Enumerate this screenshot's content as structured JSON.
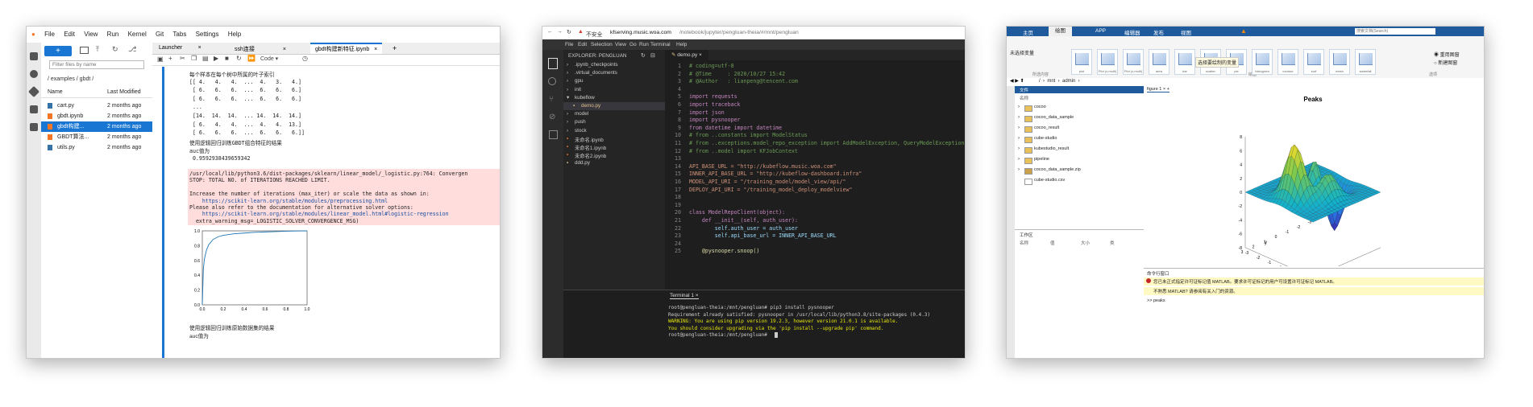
{
  "jupyter": {
    "menu": [
      "File",
      "Edit",
      "View",
      "Run",
      "Kernel",
      "Git",
      "Tabs",
      "Settings",
      "Help"
    ],
    "filter_placeholder": "Filter files by name",
    "breadcrumb": "/ examples / gbdt /",
    "col_name": "Name",
    "col_modified": "Last Modified",
    "files": [
      {
        "name": "cart.py",
        "modified": "2 months ago",
        "selected": false
      },
      {
        "name": "gbdt.ipynb",
        "modified": "2 months ago",
        "selected": false
      },
      {
        "name": "gbdt构建...",
        "modified": "2 months ago",
        "selected": true
      },
      {
        "name": "GBDT算法...",
        "modified": "2 months ago",
        "selected": false
      },
      {
        "name": "utils.py",
        "modified": "2 months ago",
        "selected": false
      }
    ],
    "tabs": [
      "Launcher",
      "ssh连接",
      "gbdt构建新特征.ipynb"
    ],
    "kernel": "Code",
    "output_lines": [
      "每个样本在每个树中所属的叶子索引",
      "[[ 4.   4.   4.  ...  4.   3.   4.]",
      " [ 6.   6.   6.  ...  6.   6.   6.]",
      " [ 6.   6.   6.  ...  6.   6.   6.]",
      " ...",
      " [14.  14.  14.  ... 14.  14.  14.]",
      " [ 6.   4.   4.  ...  4.   4.  13.]",
      " [ 6.   6.   6.  ...  6.   6.   6.]]",
      "使用逻辑回归训练GBDT组合特征的结果",
      "auc值为",
      " 0.9592938439659342"
    ],
    "warning_lines": [
      "/usr/local/lib/python3.6/dist-packages/sklearn/linear_model/_logistic.py:764: Convergen",
      "STOP: TOTAL NO. of ITERATIONS REACHED LIMIT.",
      "",
      "Increase the number of iterations (max_iter) or scale the data as shown in:",
      "    https://scikit-learn.org/stable/modules/preprocessing.html",
      "Please also refer to the documentation for alternative solver options:",
      "    https://scikit-learn.org/stable/modules/linear_model.html#logistic-regression",
      "  extra_warning_msg=_LOGISTIC_SOLVER_CONVERGENCE_MSG)"
    ],
    "after_lines": [
      "使用逻辑回归训练原始数据集的结果",
      "auc值为"
    ],
    "chart_yticks": [
      "1.0",
      "0.8",
      "0.6",
      "0.4",
      "0.2",
      "0.0"
    ],
    "chart_xticks": [
      "0.0",
      "0.2",
      "0.4",
      "0.6",
      "0.8",
      "1.0"
    ],
    "chart_data": {
      "type": "line",
      "x": [
        0,
        0.01,
        0.02,
        0.04,
        0.06,
        0.1,
        0.15,
        0.2,
        0.3,
        0.4,
        0.5,
        0.6,
        0.7,
        0.8,
        0.9,
        1.0
      ],
      "y": [
        0,
        0.48,
        0.62,
        0.74,
        0.81,
        0.88,
        0.92,
        0.94,
        0.96,
        0.97,
        0.98,
        0.985,
        0.99,
        0.995,
        0.998,
        1.0
      ],
      "xlim": [
        0,
        1
      ],
      "ylim": [
        0,
        1
      ]
    },
    "accent": "#1976d2"
  },
  "vscode": {
    "url_host": "kfserving.music.woa.com",
    "url_path": "/notebook/jupyter/pengluan-theia/#/mnt/pengluan",
    "insecure": "不安全",
    "menu": [
      "File",
      "Edit",
      "Selection",
      "View",
      "Go",
      "Run",
      "Terminal",
      "Help"
    ],
    "explorer_title": "EXPLORER: PENGLUAN",
    "tree": [
      {
        "name": ".ipynb_checkpoints",
        "type": "folder",
        "depth": 0
      },
      {
        "name": ".virtual_documents",
        "type": "folder",
        "depth": 0
      },
      {
        "name": "gpu",
        "type": "folder",
        "depth": 0
      },
      {
        "name": "init",
        "type": "folder",
        "depth": 0
      },
      {
        "name": "kubeflow",
        "type": "folder",
        "depth": 0,
        "open": true
      },
      {
        "name": "demo.py",
        "type": "file",
        "depth": 1,
        "selected": true
      },
      {
        "name": "model",
        "type": "folder",
        "depth": 0
      },
      {
        "name": "push",
        "type": "folder",
        "depth": 0
      },
      {
        "name": "stock",
        "type": "folder",
        "depth": 0
      },
      {
        "name": "未命名.ipynb",
        "type": "file",
        "depth": 0
      },
      {
        "name": "未命名1.ipynb",
        "type": "file",
        "depth": 0
      },
      {
        "name": "未命名2.ipynb",
        "type": "file",
        "depth": 0
      },
      {
        "name": "ddd.py",
        "type": "file",
        "depth": 0
      }
    ],
    "tab": "demo.py",
    "code": [
      "# coding=utf-8",
      "# @Time     : 2020/10/27 15:42",
      "# @Author   : lianpeng@tencent.com",
      "",
      "import requests",
      "import traceback",
      "import json",
      "import pysnooper",
      "from datetime import datetime",
      "# from ..constants import ModelStatus",
      "# from ..exceptions.model_repo_exception import AddModelException, QueryModelException, Update",
      "# from ..model import KFJobContext",
      "",
      "API_BASE_URL = \"http://kubeflow.music.woa.com\"",
      "INNER_API_BASE_URL = \"http://kubeflow-dashboard.infra\"",
      "MODEL_API_URI = \"/training_model/model_view/api/\"",
      "DEPLOY_API_URI = \"/training_model_deploy_modelview\"",
      "",
      "",
      "class ModelRepoClient(object):",
      "    def __init__(self, auth_user):",
      "        self.auth_user = auth_user",
      "        self.api_base_url = INNER_API_BASE_URL",
      "",
      "    @pysnooper.snoop()"
    ],
    "terminal_tab": "Terminal 1",
    "terminal": [
      {
        "t": "root@pengluan-theia:/mnt/pengluan# pip3 install pysnooper",
        "c": "#cccccc"
      },
      {
        "t": "Requirement already satisfied: pysnooper in /usr/local/lib/python3.8/site-packages (0.4.3)",
        "c": "#cccccc"
      },
      {
        "t": "WARNING: You are using pip version 19.2.3, however version 21.0.1 is available.",
        "c": "#e5e510"
      },
      {
        "t": "You should consider upgrading via the 'pip install --upgrade pip' command.",
        "c": "#e5e510"
      },
      {
        "t": "root@pengluan-theia:/mnt/pengluan# ",
        "c": "#cccccc"
      }
    ]
  },
  "matlab": {
    "tabs": [
      "主页",
      "绘图",
      "APP",
      "编辑器",
      "发布",
      "视图"
    ],
    "search_placeholder": "搜索文档(Search)",
    "selected_label": "未选择变量",
    "gallery": [
      "plot",
      "Plot (x,multi)",
      "Plot (x,multi)",
      "area",
      "bar",
      "scatter",
      "pie",
      "histogram",
      "contour",
      "surf",
      "mesh",
      "waterfall"
    ],
    "gallery_title": "选择要绘制的变量",
    "options": [
      "重用图窗",
      "新建图窗"
    ],
    "section_labels": [
      "所选内容",
      "绘图",
      "选项"
    ],
    "path": "/  ›  mnt  ›  admin  ›",
    "files_panel": "文件",
    "col_name": "名称",
    "files": [
      {
        "name": "cocoo",
        "type": "folder"
      },
      {
        "name": "cocoo_data_sample",
        "type": "folder"
      },
      {
        "name": "cocoo_result",
        "type": "folder"
      },
      {
        "name": "cube-studio",
        "type": "folder"
      },
      {
        "name": "kubestudio_result",
        "type": "folder"
      },
      {
        "name": "pipeline",
        "type": "folder"
      },
      {
        "name": "cocoo_data_sample.zip",
        "type": "zip"
      },
      {
        "name": "cube-studio.csv",
        "type": "file"
      }
    ],
    "workspace": "工作区",
    "ws_cols": [
      "名称",
      "值",
      "大小",
      "类"
    ],
    "figure_tab": "figure 1",
    "figure_title": "Peaks",
    "zticks": [
      "8",
      "6",
      "4",
      "2",
      "0",
      "-2",
      "-4",
      "-6",
      "-8"
    ],
    "xlabel": "x",
    "ylabel": "y",
    "xticks": [
      "-3",
      "-2",
      "-1",
      "0",
      "1",
      "2",
      "3"
    ],
    "yticks": [
      "3",
      "2",
      "1",
      "0",
      "-1",
      "-2",
      "-3"
    ],
    "cmd_title": "命令行窗口",
    "cmd_warning": "您已未正式指定许可证标记值 MATLAB。要求许可证标记的用户可设置许可证标记 MATLAB。",
    "cmd_notice": "不熟悉 MATLAB? 请参阅有关入门的资源。",
    "cmd_input": ">> peaks",
    "blue": "#1e5a9c"
  }
}
